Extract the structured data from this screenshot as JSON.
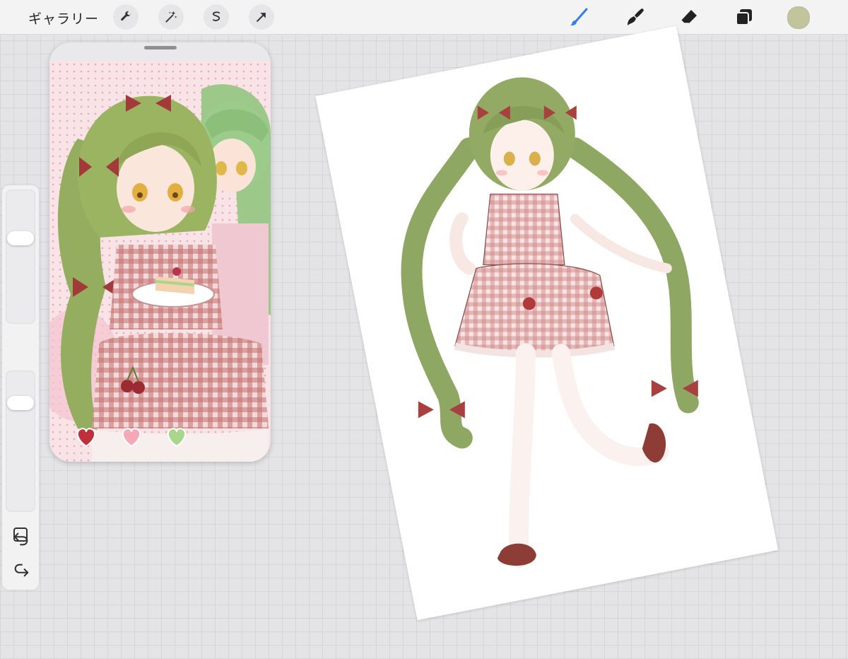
{
  "toolbar": {
    "gallery_label": "ギャラリー",
    "left_icons": [
      "wrench-icon",
      "magic-wand-icon",
      "selection-icon",
      "transform-arrow-icon"
    ],
    "right_tools": [
      "brush-icon",
      "smudge-icon",
      "eraser-icon",
      "layers-icon"
    ],
    "active_tool": "brush",
    "accent_color": "#2f7ff0",
    "current_color": "#c2c49c"
  },
  "sidebar": {
    "brush_size_level": 0.35,
    "opacity_level": 0.2,
    "icons": [
      "modify-square-icon",
      "undo-icon",
      "redo-icon"
    ]
  },
  "reference_window": {
    "content": "reference-illustration",
    "colors": {
      "hair": "#8aa55a",
      "dress": "#b85e5e",
      "background": "#f7dfe3"
    }
  },
  "canvas": {
    "content": "character-sketch",
    "colors": {
      "hair": "#8ea863",
      "dress": "#c77a7a",
      "shoes": "#8e3c36"
    }
  }
}
